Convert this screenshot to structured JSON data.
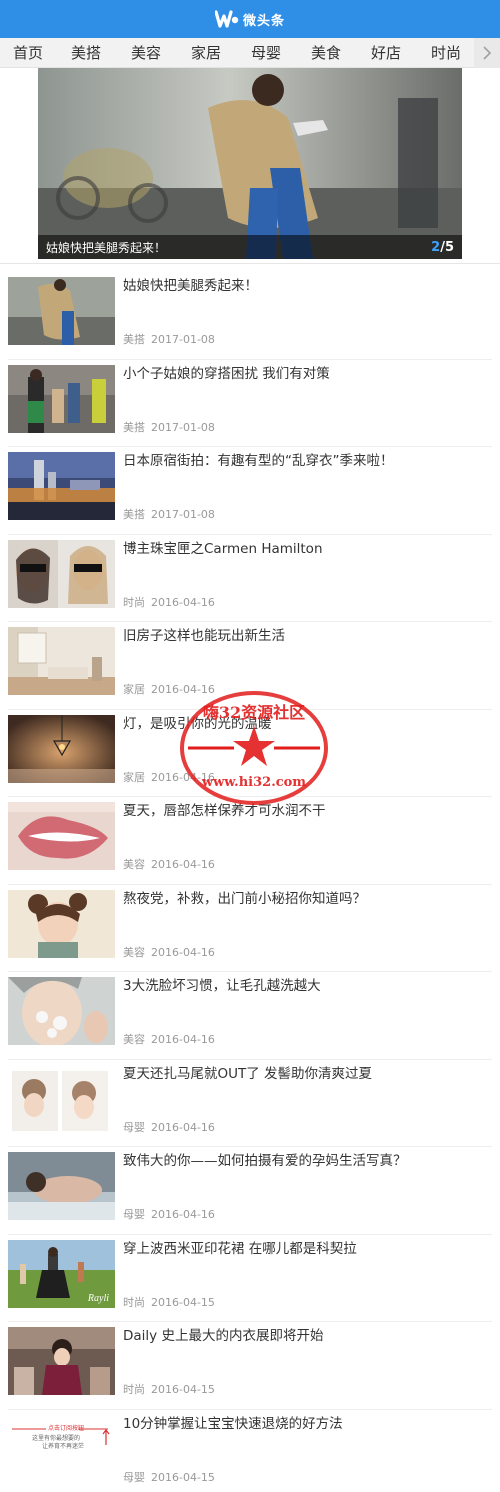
{
  "header": {
    "logo_text": "微头条",
    "logo_mark": "W"
  },
  "nav": {
    "items": [
      "首页",
      "美搭",
      "美容",
      "家居",
      "母婴",
      "美食",
      "好店",
      "时尚"
    ],
    "more_icon": "chevron-right-icon"
  },
  "banner": {
    "caption": "姑娘快把美腿秀起来！",
    "current": "2",
    "separator": "/",
    "total": "5"
  },
  "articles": [
    {
      "title": "姑娘快把美腿秀起来！",
      "category": "美搭",
      "date": "2017-01-08"
    },
    {
      "title": "小个子姑娘的穿搭困扰 我们有对策",
      "category": "美搭",
      "date": "2017-01-08"
    },
    {
      "title": "日本原宿街拍：有趣有型的“乱穿衣”季来啦！",
      "category": "美搭",
      "date": "2017-01-08"
    },
    {
      "title": "博主珠宝匣之Carmen Hamilton",
      "category": "时尚",
      "date": "2016-04-16"
    },
    {
      "title": "旧房子这样也能玩出新生活",
      "category": "家居",
      "date": "2016-04-16"
    },
    {
      "title": "灯，是吸引你的光的温暖",
      "category": "家居",
      "date": "2016-04-16"
    },
    {
      "title": "夏天，唇部怎样保养才可水润不干",
      "category": "美容",
      "date": "2016-04-16"
    },
    {
      "title": "熬夜党，补救，出门前小秘招你知道吗？",
      "category": "美容",
      "date": "2016-04-16"
    },
    {
      "title": "3大洗脸坏习惯，让毛孔越洗越大",
      "category": "美容",
      "date": "2016-04-16"
    },
    {
      "title": "夏天还扎马尾就OUT了 发髻助你清爽过夏",
      "category": "母婴",
      "date": "2016-04-16"
    },
    {
      "title": "致伟大的你——如何拍摄有爱的孕妈生活写真？",
      "category": "母婴",
      "date": "2016-04-16"
    },
    {
      "title": "穿上波西米亚印花裙 在哪儿都是科契拉",
      "category": "时尚",
      "date": "2016-04-15"
    },
    {
      "title": "Daily 史上最大的内衣展即将开始",
      "category": "时尚",
      "date": "2016-04-15"
    },
    {
      "title": "10分钟掌握让宝宝快速退烧的好方法",
      "category": "母婴",
      "date": "2016-04-15"
    }
  ],
  "thumb_text": {
    "rayli": "Rayli",
    "notice_a": "点击订阅按钮",
    "notice_b": "这里有你最想要的",
    "notice_c": "让养育不再迷茫"
  },
  "watermark": {
    "text": "嗨32资源社区",
    "url": "www.hi32.com",
    "color": "#e21b1b"
  },
  "colors": {
    "header": "#2f8fe6",
    "accent": "#3da3ff"
  }
}
